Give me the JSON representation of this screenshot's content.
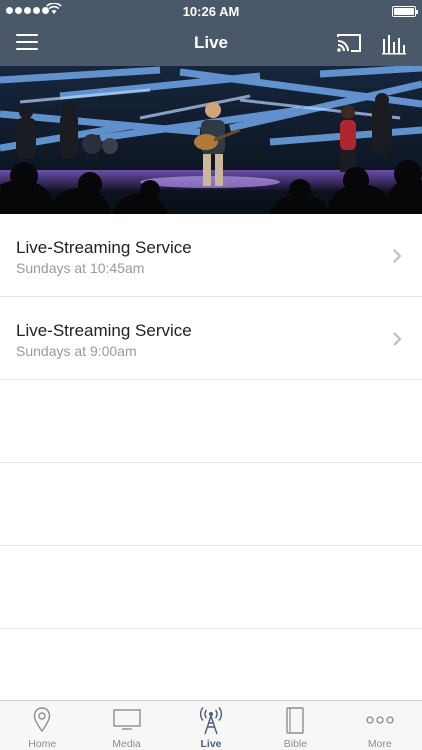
{
  "status_bar": {
    "time": "10:26 AM"
  },
  "navbar": {
    "title": "Live"
  },
  "services": [
    {
      "title": "Live-Streaming Service",
      "subtitle": "Sundays at 10:45am"
    },
    {
      "title": "Live-Streaming Service",
      "subtitle": "Sundays at 9:00am"
    }
  ],
  "tabs": [
    {
      "label": "Home",
      "icon": "map-pin-icon"
    },
    {
      "label": "Media",
      "icon": "tv-icon"
    },
    {
      "label": "Live",
      "icon": "broadcast-tower-icon",
      "active": true
    },
    {
      "label": "Bible",
      "icon": "book-icon"
    },
    {
      "label": "More",
      "icon": "more-dots-icon"
    }
  ],
  "colors": {
    "header": "#4b586a",
    "active_tab": "#4b5e78",
    "inactive_tab": "#8e8e93"
  }
}
